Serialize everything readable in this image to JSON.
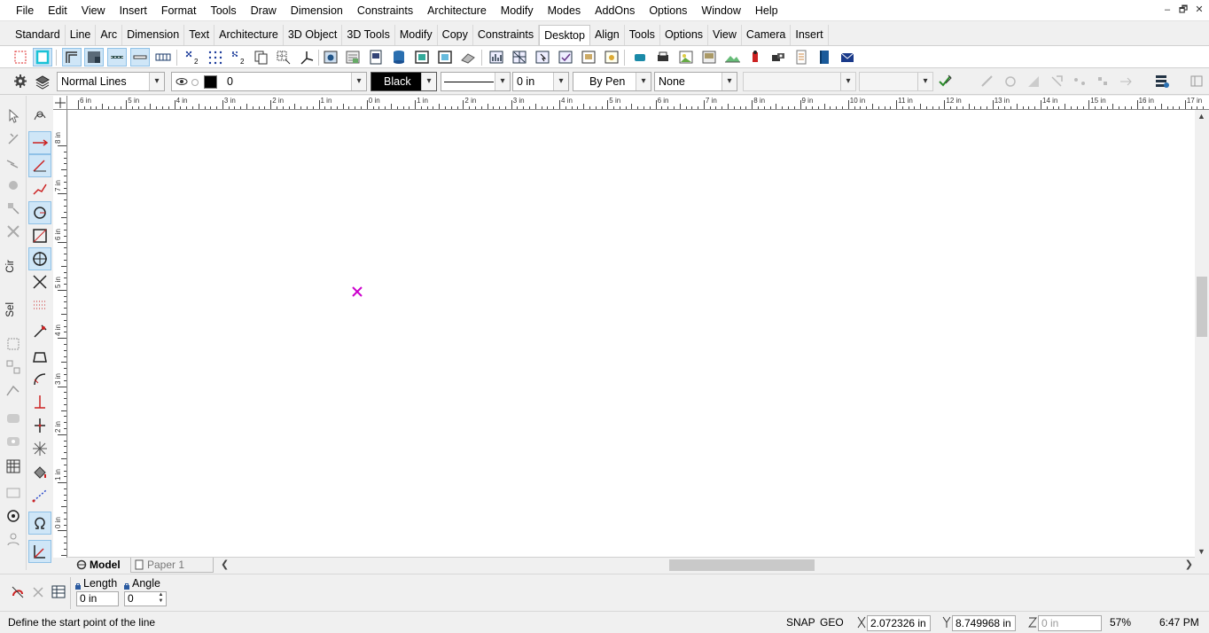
{
  "menubar": {
    "items": [
      "File",
      "Edit",
      "View",
      "Insert",
      "Format",
      "Tools",
      "Draw",
      "Dimension",
      "Constraints",
      "Architecture",
      "Modify",
      "Modes",
      "AddOns",
      "Options",
      "Window",
      "Help"
    ]
  },
  "window_controls": {
    "minimize": "–",
    "restore": "🗗",
    "close": "✕"
  },
  "toolbar_tabs": {
    "items": [
      "Standard",
      "Line",
      "Arc",
      "Dimension",
      "Text",
      "Architecture",
      "3D Object",
      "3D Tools",
      "Modify",
      "Copy",
      "Constraints",
      "Desktop",
      "Align",
      "Tools",
      "Options",
      "View",
      "Camera",
      "Insert"
    ],
    "active": "Desktop"
  },
  "properties": {
    "line_style": "Normal Lines",
    "layer": "0",
    "color_name": "Black",
    "line_width": "0 in",
    "pen": "By Pen",
    "fill": "None",
    "colors": {
      "swatch": "#000000",
      "accent": "#cfe6f7"
    }
  },
  "ruler": {
    "top_labels": [
      "6 in",
      "5 in",
      "4 in",
      "3 in",
      "2 in",
      "1 in",
      "0 in",
      "1 in",
      "2 in",
      "3 in",
      "4 in",
      "5 in",
      "6 in",
      "7 in",
      "8 in",
      "9 in",
      "10 in",
      "11 in",
      "12 in",
      "13 in",
      "14 in",
      "15 in",
      "16 in",
      "17 in"
    ],
    "left_labels": [
      "8 in",
      "7 in",
      "6 in",
      "5 in",
      "4 in",
      "3 in",
      "2 in",
      "1 in",
      "0 in"
    ]
  },
  "palette_labels": {
    "cir": "Cir",
    "sel": "Sel"
  },
  "icons": {
    "left_palette_1": [
      "pointer-icon",
      "node-edit-icon",
      "reshape-icon",
      "ball-icon",
      "move-points-icon",
      "delete-icon",
      "align-group-icon",
      "transform-icon",
      "vector-icon",
      "fill-icon",
      "library-icon",
      "pattern-icon",
      "snapshot-icon",
      "camera-icon",
      "user-icon"
    ],
    "left_palette_2": [
      "freehand-icon",
      "line-arrow-icon",
      "angle-line-icon",
      "polyline-icon",
      "circle-icon",
      "box-3d-icon",
      "circle-cross-icon",
      "x-lines-icon",
      "grid-dots-icon",
      "eyedropper-icon",
      "trapezoid-icon",
      "arc-tangent-icon",
      "perpendicular-icon",
      "cross-point-icon",
      "star-lines-icon",
      "bucket-icon",
      "dashed-line-icon",
      "omega-icon",
      "normal-icon"
    ]
  },
  "bottom_tabs": [
    {
      "label": "Model",
      "active": true
    },
    {
      "label": "Paper 1",
      "active": false
    }
  ],
  "inputs": {
    "length": {
      "label": "Length",
      "value": "0 in"
    },
    "angle": {
      "label": "Angle",
      "value": "0"
    }
  },
  "status": {
    "message": "Define the start point of the line",
    "snap": "SNAP",
    "geo": "GEO",
    "x": "2.072326 in",
    "y": "8.749968 in",
    "z": "0 in",
    "zoom": "57%",
    "time": "6:47 PM"
  },
  "marker": {
    "color": "#cc00cc"
  }
}
